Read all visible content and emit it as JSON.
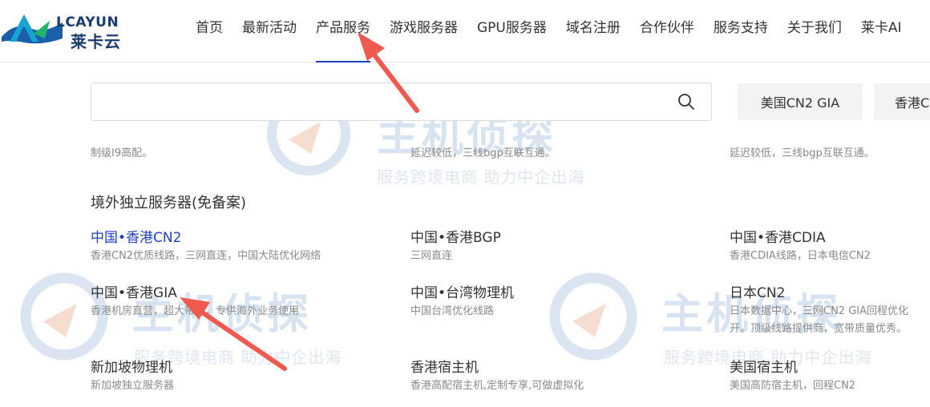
{
  "brand": {
    "name_en": "LCAYUN",
    "name_cn": "莱卡云"
  },
  "nav": {
    "items": [
      {
        "label": "首页"
      },
      {
        "label": "最新活动"
      },
      {
        "label": "产品服务"
      },
      {
        "label": "游戏服务器"
      },
      {
        "label": "GPU服务器"
      },
      {
        "label": "域名注册"
      },
      {
        "label": "合作伙伴"
      },
      {
        "label": "服务支持"
      },
      {
        "label": "关于我们"
      },
      {
        "label": "莱卡AI"
      }
    ],
    "active": "产品服务"
  },
  "search": {
    "placeholder": "",
    "value": ""
  },
  "quick_tags": [
    {
      "label": "美国CN2 GIA"
    },
    {
      "label": "香港C"
    }
  ],
  "top_descs": [
    "制级I9高配。",
    "延迟较低，三线bgp互联互通。",
    "延迟较低，三线bgp互联互通。"
  ],
  "section": {
    "title": "境外独立服务器(免备案)",
    "products": [
      {
        "title": "中国•香港CN2",
        "desc": "香港CN2优质线路，三网直连，中国大陆优化网络"
      },
      {
        "title": "中国•香港BGP",
        "desc": "三网直连"
      },
      {
        "title": "中国•香港CDIA",
        "desc": "香港CDIA线路，日本电信CN2"
      },
      {
        "title": "中国•香港GIA",
        "desc": "香港机房直营，超大带宽，专供海外业务使用"
      },
      {
        "title": "中国•台湾物理机",
        "desc": "中国台湾优化线路"
      },
      {
        "title": "日本CN2",
        "desc": "日本数据中心，三网CN2 GIA回程优化",
        "desc2": "开。顶级线路提供商，宽带质量优秀。"
      },
      {
        "title": "新加坡物理机",
        "desc": "新加坡独立服务器"
      },
      {
        "title": "香港宿主机",
        "desc": "香港高配宿主机,定制专享,可做虚拟化"
      },
      {
        "title": "美国宿主机",
        "desc": "美国高防宿主机，回程CN2"
      }
    ]
  },
  "watermark": {
    "text": "服务跨境电商 助力中企出海",
    "big": "主机侦探"
  },
  "colors": {
    "accent": "#1f3fc6",
    "arrow": "#ee5a4f"
  },
  "icons": {
    "search": "search-icon",
    "logo": "logo-icon",
    "arrow": "arrow-icon"
  }
}
